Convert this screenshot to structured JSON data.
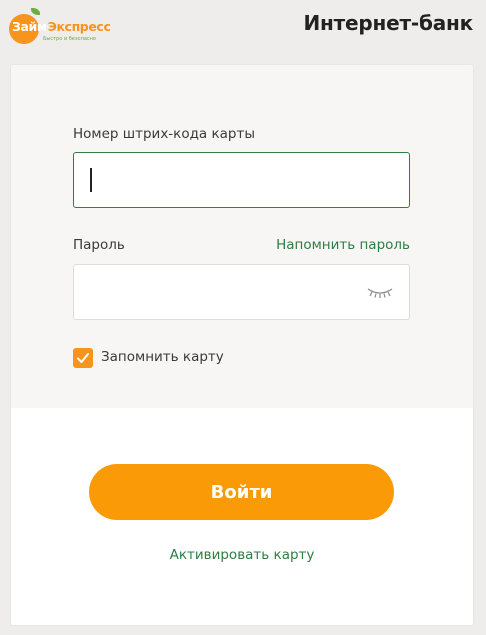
{
  "header": {
    "logo": {
      "part1": "Займ",
      "part2": "Экспресс",
      "tagline": "Быстро и безопасно"
    },
    "title": "Интернет-банк"
  },
  "form": {
    "card_label": "Номер штрих-кода карты",
    "card_value": "",
    "password_label": "Пароль",
    "password_value": "",
    "remind_password": "Напомнить пароль",
    "remember_label": "Запомнить карту",
    "remember_checked": true
  },
  "actions": {
    "login": "Войти",
    "activate": "Активировать карту"
  },
  "colors": {
    "accent": "#fb9a07",
    "link": "#2e7d44",
    "background": "#eeedeb"
  },
  "icons": {
    "password_toggle": "eye-closed-icon",
    "checkbox": "checkmark-icon"
  }
}
